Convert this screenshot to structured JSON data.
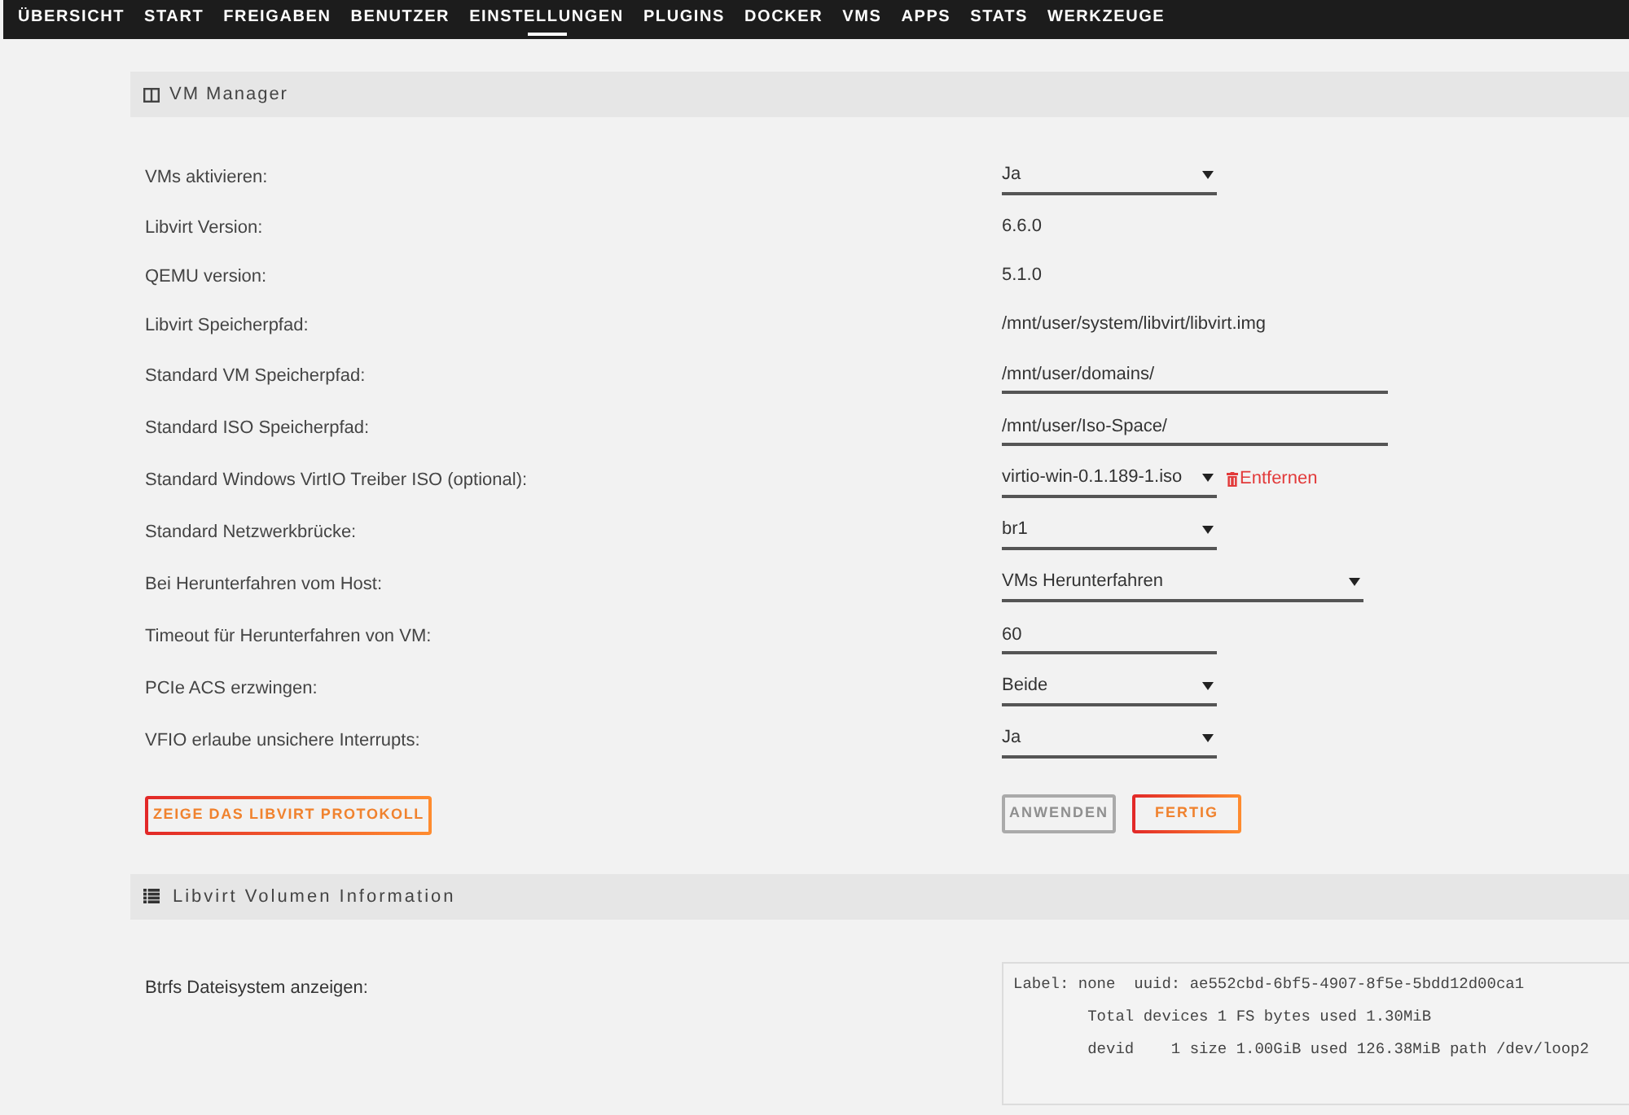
{
  "nav": {
    "items": [
      {
        "label": "ÜBERSICHT",
        "selected": false
      },
      {
        "label": "START",
        "selected": false
      },
      {
        "label": "FREIGABEN",
        "selected": false
      },
      {
        "label": "BENUTZER",
        "selected": false
      },
      {
        "label": "EINSTELLUNGEN",
        "selected": true
      },
      {
        "label": "PLUGINS",
        "selected": false
      },
      {
        "label": "DOCKER",
        "selected": false
      },
      {
        "label": "VMS",
        "selected": false
      },
      {
        "label": "APPS",
        "selected": false
      },
      {
        "label": "STATS",
        "selected": false
      },
      {
        "label": "WERKZEUGE",
        "selected": false
      }
    ]
  },
  "vm_manager": {
    "title": "VM Manager",
    "rows": [
      {
        "label": "VMs aktivieren:",
        "kind": "select",
        "value": "Ja"
      },
      {
        "label": "Libvirt Version:",
        "kind": "text",
        "value": "6.6.0"
      },
      {
        "label": "QEMU version:",
        "kind": "text",
        "value": "5.1.0"
      },
      {
        "label": "Libvirt Speicherpfad:",
        "kind": "text",
        "value": "/mnt/user/system/libvirt/libvirt.img"
      },
      {
        "label": "Standard VM Speicherpfad:",
        "kind": "input",
        "value": "/mnt/user/domains/"
      },
      {
        "label": "Standard ISO Speicherpfad:",
        "kind": "input",
        "value": "/mnt/user/Iso-Space/"
      },
      {
        "label": "Standard Windows VirtIO Treiber ISO (optional):",
        "kind": "select",
        "value": "virtio-win-0.1.189-1.iso",
        "action": "Entfernen"
      },
      {
        "label": "Standard Netzwerkbrücke:",
        "kind": "select",
        "value": "br1"
      },
      {
        "label": "Bei Herunterfahren vom Host:",
        "kind": "select",
        "value": "VMs Herunterfahren"
      },
      {
        "label": "Timeout für Herunterfahren von VM:",
        "kind": "input",
        "value": "60"
      },
      {
        "label": "PCIe ACS erzwingen:",
        "kind": "select",
        "value": "Beide"
      },
      {
        "label": "VFIO erlaube unsichere Interrupts:",
        "kind": "select",
        "value": "Ja"
      }
    ],
    "log_button": {
      "label": "ZEIGE DAS LIBVIRT PROTOKOLL"
    },
    "actions": [
      {
        "label": "ANWENDEN",
        "disabled": true
      },
      {
        "label": "FERTIG",
        "disabled": false
      }
    ]
  },
  "volume_info": {
    "title": "Libvirt Volumen Information",
    "label": "Btrfs Dateisystem anzeigen:",
    "output": [
      "Label: none  uuid: ae552cbd-6bf5-4907-8f5e-5bdd12d00ca1",
      "        Total devices 1 FS bytes used 1.30MiB",
      "        devid    1 size 1.00GiB used 126.38MiB path /dev/loop2"
    ]
  }
}
